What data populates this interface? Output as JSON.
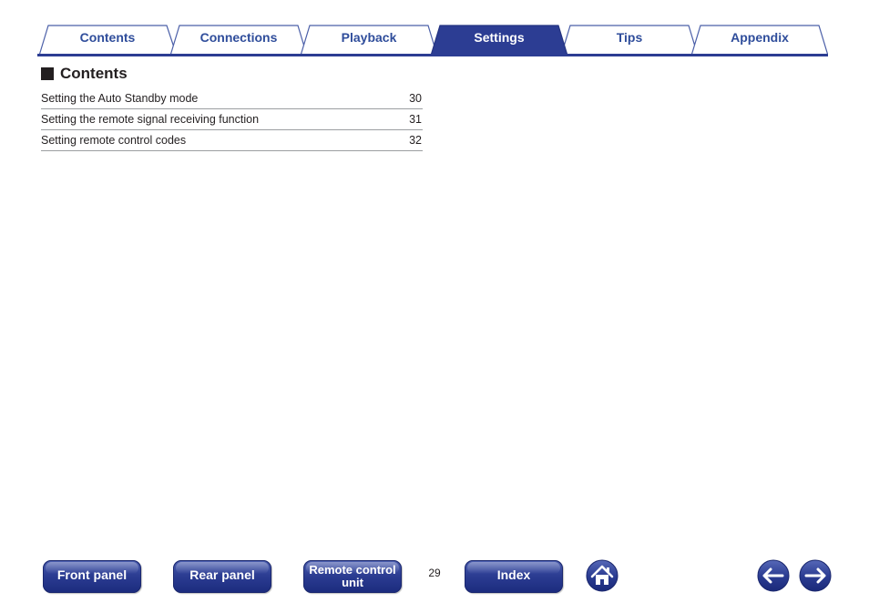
{
  "tabs": [
    {
      "label": "Contents",
      "active": false
    },
    {
      "label": "Connections",
      "active": false
    },
    {
      "label": "Playback",
      "active": false
    },
    {
      "label": "Settings",
      "active": true
    },
    {
      "label": "Tips",
      "active": false
    },
    {
      "label": "Appendix",
      "active": false
    }
  ],
  "section": {
    "title": "Contents"
  },
  "toc": [
    {
      "label": "Setting the Auto Standby mode",
      "page": "30"
    },
    {
      "label": "Setting the remote signal receiving function",
      "page": "31"
    },
    {
      "label": "Setting remote control codes",
      "page": "32"
    }
  ],
  "footer": {
    "front_panel": "Front panel",
    "rear_panel": "Rear panel",
    "remote_line1": "Remote control",
    "remote_line2": "unit",
    "page_number": "29",
    "index": "Index",
    "home_icon": "home-icon",
    "back_icon": "arrow-left-icon",
    "forward_icon": "arrow-right-icon"
  },
  "colors": {
    "tab_text": "#2f4d9b",
    "tab_active_fill": "#2c3d93",
    "button_fill": "#2c3d93"
  }
}
